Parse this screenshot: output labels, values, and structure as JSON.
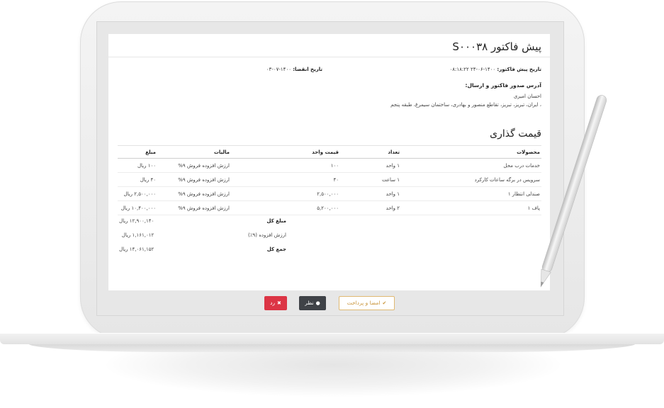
{
  "quote": {
    "title": "پیش فاکتور S۰۰۰۳۸",
    "quote_date_label": "تاریخ پیش فاکتور:",
    "quote_date_value": "۱۴۰۰-۰۶-۲۴ ۰۸:۱۸:۲۲",
    "due_date_label": "تاریخ انقضا:",
    "due_date_value": "۱۴۰۰-۰۷-۰۳",
    "address_title": "آدرس صدور فاکتور و ارسال:",
    "customer_name": "احسان امیری",
    "customer_address": "، ایران، تبریز، تبریز، تقاطع منصور و بهادری، ساختمان سیمرغ، طبقه پنجم"
  },
  "pricing": {
    "section_title": "قیمت گذاری",
    "columns": [
      "محصولات",
      "تعداد",
      "قیمت واحد",
      "مالیات",
      "مبلغ"
    ],
    "rows": [
      {
        "product": "خدمات درب محل",
        "qty": "۱ واحد",
        "unit_price": "۱۰۰",
        "tax": "ارزش افزوده فروش ۹%",
        "amount": "۱۰۰ ریال"
      },
      {
        "product": "سرویس در برگه ساعات کارکرد",
        "qty": "۱ ساعت",
        "unit_price": "۴۰",
        "tax": "ارزش افزوده فروش ۹%",
        "amount": "۴۰ ریال"
      },
      {
        "product": "صندلی انتظار ۱",
        "qty": "۱ واحد",
        "unit_price": "۲,۵۰۰,۰۰۰",
        "tax": "ارزش افزوده فروش ۹%",
        "amount": "۲,۵۰۰,۰۰۰ ریال"
      },
      {
        "product": "پاف ۱",
        "qty": "۲ واحد",
        "unit_price": "۵,۲۰۰,۰۰۰",
        "tax": "ارزش افزوده فروش ۹%",
        "amount": "۱۰,۴۰۰,۰۰۰ ریال"
      }
    ],
    "totals": [
      {
        "label": "مبلغ کل",
        "value": "۱۲,۹۰۰,۱۴۰ ریال",
        "bold": true
      },
      {
        "label": "ارزش افزوده (۹٪)",
        "value": "۱,۱۶۱,۰۱۲ ریال",
        "bold": false
      },
      {
        "label": "جمع کل",
        "value": "۱۴,۰۶۱,۱۵۲ ریال",
        "bold": true
      }
    ]
  },
  "actions": {
    "sign_pay_label": "امضا و پرداخت",
    "comment_label": "نظر",
    "reject_label": "رد"
  },
  "colors": {
    "sign_pay_border": "#e0b972",
    "comment_bg": "#3f4247",
    "reject_bg": "#dc3545"
  },
  "icons": {
    "sign_pay": "check-icon",
    "comment": "comment-icon",
    "reject": "close-icon"
  }
}
